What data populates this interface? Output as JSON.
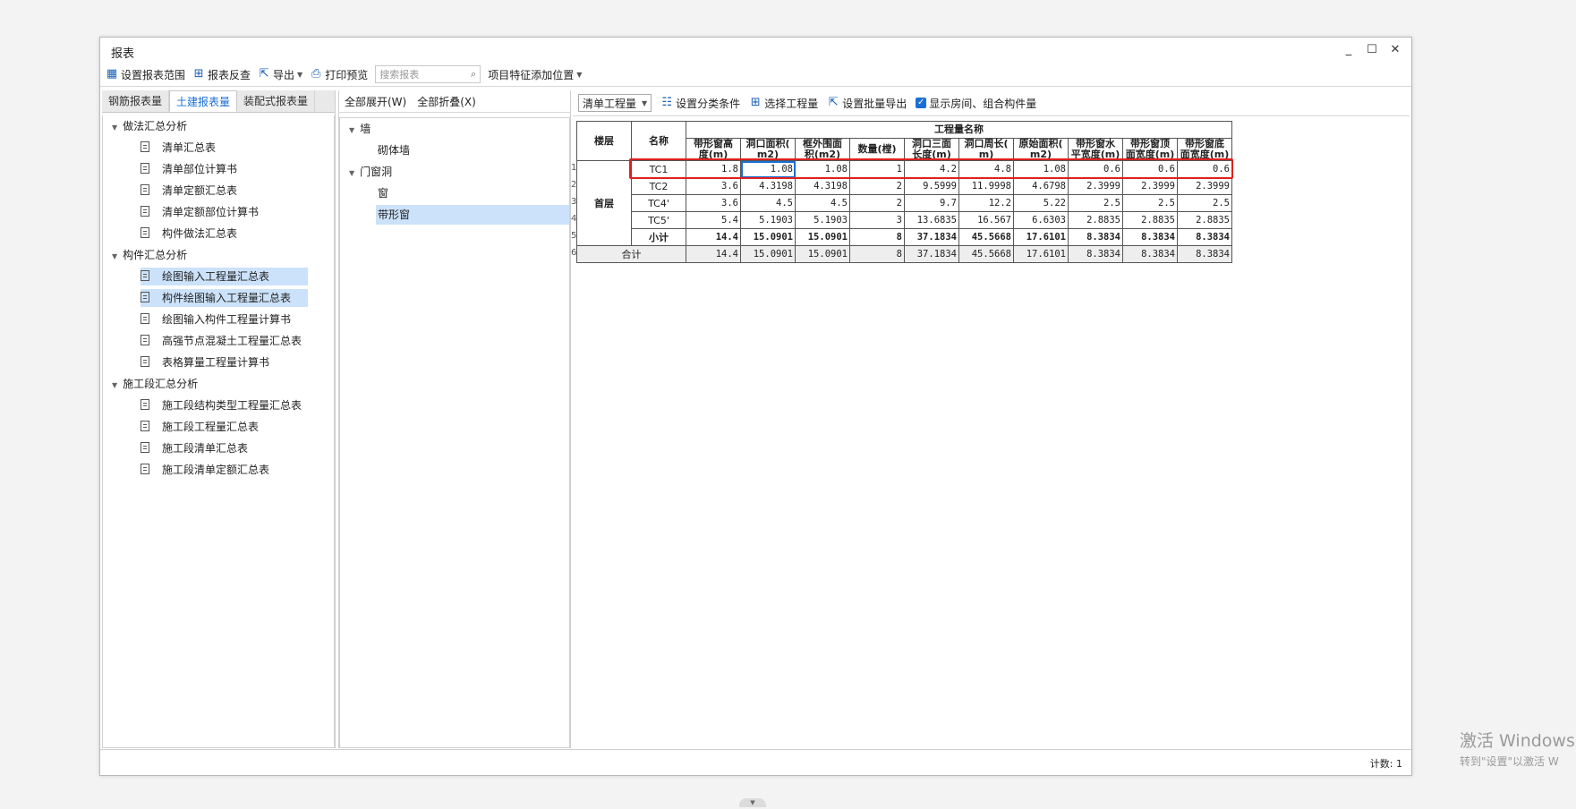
{
  "window": {
    "title": "报表",
    "controls": [
      "_",
      "☐",
      "✕"
    ]
  },
  "toolbar": {
    "set_range": "设置报表范围",
    "reverse": "报表反查",
    "export": "导出",
    "print_preview": "打印预览",
    "search_placeholder": "搜索报表",
    "add_position": "项目特征添加位置"
  },
  "left_tabs": [
    "钢筋报表量",
    "土建报表量",
    "装配式报表量"
  ],
  "left_tree": {
    "g1": "做法汇总分析",
    "g1_items": [
      "清单汇总表",
      "清单部位计算书",
      "清单定额汇总表",
      "清单定额部位计算书",
      "构件做法汇总表"
    ],
    "g2": "构件汇总分析",
    "g2_items": [
      "绘图输入工程量汇总表",
      "构件绘图输入工程量汇总表",
      "绘图输入构件工程量计算书",
      "高强节点混凝土工程量汇总表",
      "表格算量工程量计算书"
    ],
    "g3": "施工段汇总分析",
    "g3_items": [
      "施工段结构类型工程量汇总表",
      "施工段工程量汇总表",
      "施工段清单汇总表",
      "施工段清单定额汇总表"
    ]
  },
  "mid": {
    "expand_all": "全部展开(W)",
    "collapse_all": "全部折叠(X)",
    "n1": "墙",
    "n1_child": "砌体墙",
    "n2": "门窗洞",
    "n2_children": [
      "窗",
      "带形窗"
    ]
  },
  "right_toolbar": {
    "select_value": "清单工程量",
    "set_category": "设置分类条件",
    "select_quantity": "选择工程量",
    "batch_export": "设置批量导出",
    "show_rooms": "显示房间、组合构件量"
  },
  "table": {
    "h_floor": "楼层",
    "h_name": "名称",
    "h_group": "工程量名称",
    "cols": [
      "带形窗高\n度(m)",
      "洞口面积(\nm2)",
      "框外围面\n积(m2)",
      "数量(樘)",
      "洞口三面\n长度(m)",
      "洞口周长(\nm)",
      "原始面积(\nm2)",
      "带形窗水\n平宽度(m)",
      "带形窗顶\n面宽度(m)",
      "带形窗底\n面宽度(m)"
    ],
    "floor": "首层",
    "rows": [
      {
        "n": "1",
        "name": "TC1",
        "v": [
          "1.8",
          "1.08",
          "1.08",
          "1",
          "4.2",
          "4.8",
          "1.08",
          "0.6",
          "0.6",
          "0.6"
        ]
      },
      {
        "n": "2",
        "name": "TC2",
        "v": [
          "3.6",
          "4.3198",
          "4.3198",
          "2",
          "9.5999",
          "11.9998",
          "4.6798",
          "2.3999",
          "2.3999",
          "2.3999"
        ]
      },
      {
        "n": "3",
        "name": "TC4'",
        "v": [
          "3.6",
          "4.5",
          "4.5",
          "2",
          "9.7",
          "12.2",
          "5.22",
          "2.5",
          "2.5",
          "2.5"
        ]
      },
      {
        "n": "4",
        "name": "TC5'",
        "v": [
          "5.4",
          "5.1903",
          "5.1903",
          "3",
          "13.6835",
          "16.567",
          "6.6303",
          "2.8835",
          "2.8835",
          "2.8835"
        ]
      }
    ],
    "subtotal": {
      "n": "5",
      "name": "小计",
      "v": [
        "14.4",
        "15.0901",
        "15.0901",
        "8",
        "37.1834",
        "45.5668",
        "17.6101",
        "8.3834",
        "8.3834",
        "8.3834"
      ]
    },
    "total": {
      "n": "6",
      "name": "合计",
      "v": [
        "14.4",
        "15.0901",
        "15.0901",
        "8",
        "37.1834",
        "45.5668",
        "17.6101",
        "8.3834",
        "8.3834",
        "8.3834"
      ]
    }
  },
  "status": {
    "count": "计数: 1"
  },
  "watermark": {
    "line1": "激活 Windows",
    "line2": "转到\"设置\"以激活 W"
  }
}
